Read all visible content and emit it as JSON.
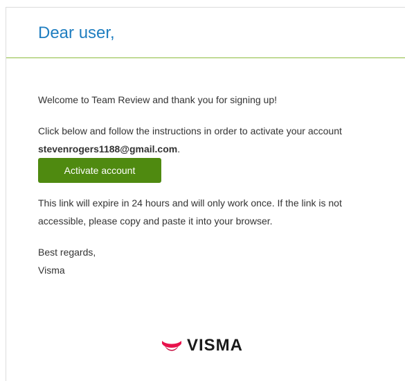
{
  "email": {
    "greeting": "Dear user,",
    "welcome_text": "Welcome to Team Review and thank you for signing up!",
    "instructions_text": "Click below and follow the instructions in order to activate your account ",
    "email_address": "stevenrogers1188@gmail.com",
    "instructions_suffix": ".",
    "activate_label": "Activate account",
    "expiry_text": "This link will expire in 24 hours and will only work once. If the link is not accessible, please copy and paste it into your browser.",
    "regards": "Best regards,",
    "signature": "Visma",
    "logo_text": "VISMA"
  },
  "colors": {
    "greeting_blue": "#1f7ec0",
    "divider_green": "#8cbb3f",
    "button_green": "#4f8a10",
    "logo_red": "#e8114b"
  },
  "icons": {
    "logo_mark": "visma-logo-icon"
  }
}
